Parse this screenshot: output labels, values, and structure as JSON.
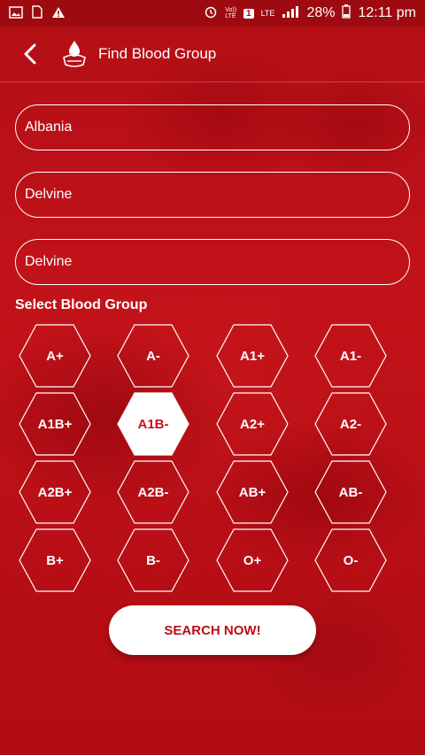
{
  "statusbar": {
    "left_icons": [
      "image-icon",
      "sim-icon",
      "warning-icon"
    ],
    "volte_label": "Vo))\nLTE",
    "sim_slot": "1",
    "network": "LTE",
    "battery": "28%",
    "time": "12:11 pm"
  },
  "header": {
    "title": "Find Blood Group"
  },
  "form": {
    "country": "Albania",
    "state": "Delvine",
    "city": "Delvine"
  },
  "blood": {
    "label": "Select Blood Group",
    "groups": [
      "A+",
      "A-",
      "A1+",
      "A1-",
      "A1B+",
      "A1B-",
      "A2+",
      "A2-",
      "A2B+",
      "A2B-",
      "AB+",
      "AB-",
      "B+",
      "B-",
      "O+",
      "O-"
    ],
    "selected": "A1B-"
  },
  "actions": {
    "search_label": "SEARCH NOW!"
  },
  "colors": {
    "primary": "#b00d14",
    "selected_text": "#c8101a"
  }
}
